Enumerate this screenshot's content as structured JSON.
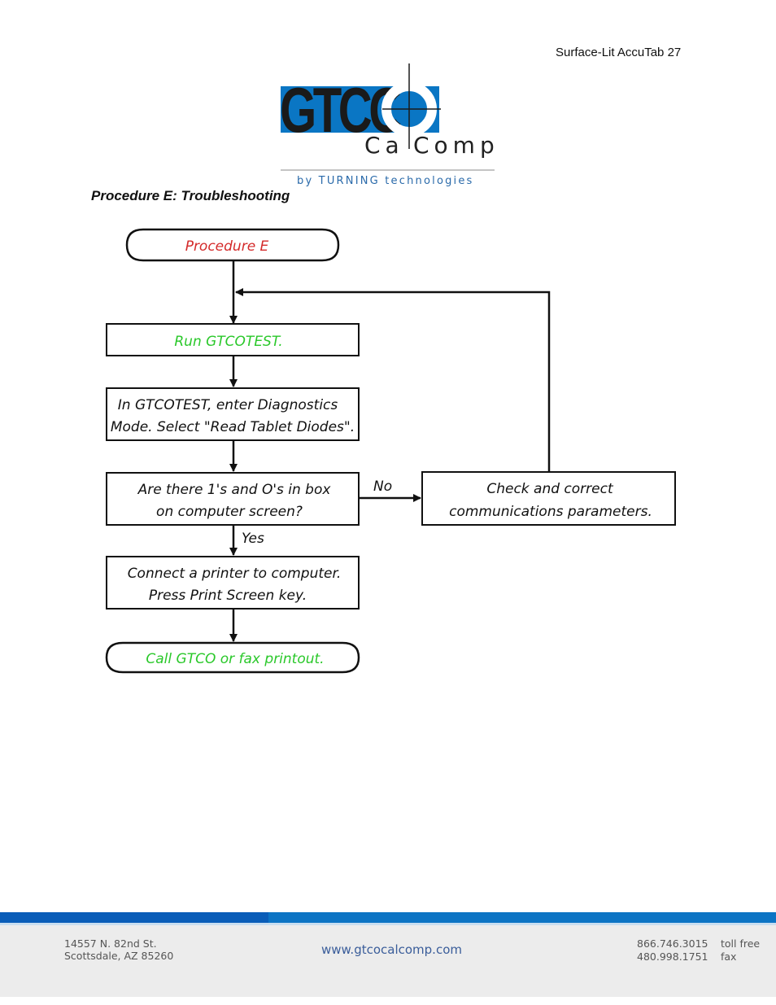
{
  "header": {
    "page_label": "Surface-Lit AccuTab 27"
  },
  "logo": {
    "brand_primary": "GTCO",
    "brand_secondary": "CalComp",
    "brand_secondary_left": "Ca",
    "brand_secondary_right": "Comp",
    "tagline": "by TURNING technologies",
    "colors": {
      "blue": "#0a76c4",
      "black": "#1a1a1a",
      "tagline": "#2a6aaa"
    }
  },
  "section": {
    "title": "Procedure E: Troubleshooting"
  },
  "flowchart": {
    "colors": {
      "start_text": "#d42a2a",
      "green_text": "#2ac82a",
      "normal_text": "#111111",
      "line": "#111111"
    },
    "nodes": {
      "start": {
        "label": "Procedure E",
        "shape": "terminator"
      },
      "run": {
        "label": "Run GTCOTEST.",
        "shape": "process"
      },
      "diag": {
        "lines": [
          "In GTCOTEST, enter Diagnostics",
          "Mode.  Select \"Read Tablet Diodes\"."
        ],
        "shape": "process"
      },
      "decision": {
        "lines": [
          "Are there 1's and O's in box",
          "on computer screen?"
        ],
        "shape": "process"
      },
      "check": {
        "lines": [
          "Check and correct",
          "communications parameters."
        ],
        "shape": "process"
      },
      "printer": {
        "lines": [
          "Connect a printer to computer.",
          "Press Print Screen key."
        ],
        "shape": "process"
      },
      "end": {
        "label": "Call GTCO or fax printout.",
        "shape": "terminator"
      }
    },
    "edge_labels": {
      "no": "No",
      "yes": "Yes"
    }
  },
  "footer": {
    "address": [
      "14557 N. 82nd St.",
      "Scottsdale, AZ 85260"
    ],
    "website": "www.gtcocalcomp.com",
    "phones": [
      {
        "number": "866.746.3015",
        "label": "toll free"
      },
      {
        "number": "480.998.1751",
        "label": "fax"
      }
    ]
  }
}
